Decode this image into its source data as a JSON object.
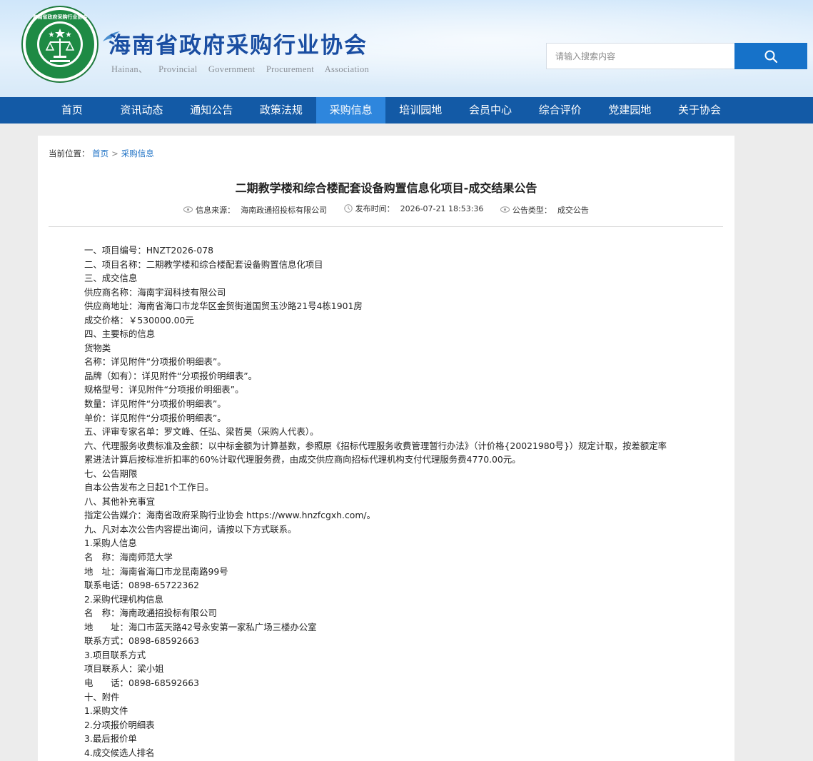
{
  "header": {
    "site_title": "海南省政府采购行业协会",
    "site_subtitle": "Hainan、 Provincial Government Procurement Association",
    "logo_name": "association-seal-logo",
    "search": {
      "placeholder": "请输入搜索内容",
      "icon": "search-icon"
    }
  },
  "nav": {
    "items": [
      {
        "label": "首页"
      },
      {
        "label": "资讯动态"
      },
      {
        "label": "通知公告"
      },
      {
        "label": "政策法规"
      },
      {
        "label": "采购信息",
        "active": true
      },
      {
        "label": "培训园地"
      },
      {
        "label": "会员中心"
      },
      {
        "label": "综合评价"
      },
      {
        "label": "党建园地"
      },
      {
        "label": "关于协会"
      }
    ],
    "active_color": "#2e86dd",
    "bar_color": "#135aa6"
  },
  "breadcrumb": {
    "prefix": "当前位置：",
    "home": "首页",
    "separator": ">",
    "current": "采购信息"
  },
  "article": {
    "title": "二期教学楼和综合楼配套设备购置信息化项目-成交结果公告",
    "meta": {
      "source_label": "信息来源：",
      "source": "海南政通招投标有限公司",
      "time_label": "发布时间：",
      "time": "2026-07-21 18:53:36",
      "type_label": "公告类型：",
      "type": "成交公告"
    },
    "lines": [
      "一、项目编号：HNZT2026-078",
      "二、项目名称：二期教学楼和综合楼配套设备购置信息化项目",
      "三、成交信息",
      "供应商名称：海南宇润科技有限公司",
      "供应商地址：海南省海口市龙华区金贸街道国贸玉沙路21号4栋1901房",
      "成交价格：￥530000.00元",
      "四、主要标的信息",
      "货物类",
      "名称：详见附件“分项报价明细表”。",
      "品牌（如有）：详见附件“分项报价明细表”。",
      "规格型号：详见附件“分项报价明细表”。",
      "数量：详见附件“分项报价明细表”。",
      "单价：详见附件“分项报价明细表”。",
      "五、评审专家名单：罗文峰、任弘、梁哲昊（采购人代表）。",
      "六、代理服务收费标准及金额：以中标金额为计算基数，参照原《招标代理服务收费管理暂行办法》（计价格{20021980号}）规定计取，按差额定率",
      "累进法计算后按标准折扣率的60%计取代理服务费，由成交供应商向招标代理机构支付代理服务费4770.00元。",
      "七、公告期限",
      "自本公告发布之日起1个工作日。",
      "八、其他补充事宜",
      "指定公告媒介：海南省政府采购行业协会 https://www.hnzfcgxh.com/。",
      "九、凡对本次公告内容提出询问，请按以下方式联系。",
      "1.采购人信息",
      "名　称：海南师范大学",
      "地　址：海南省海口市龙昆南路99号",
      "联系电话：0898-65722362",
      "2.采购代理机构信息",
      "名　称：海南政通招投标有限公司",
      "地　　址：海口市蓝天路42号永安第一家私广场三楼办公室",
      "联系方式：0898-68592663",
      "3.项目联系方式",
      "项目联系人：梁小姐",
      "电　　话：0898-68592663",
      "十、附件",
      "1.采购文件",
      "2.分项报价明细表",
      "3.最后报价单",
      "4.成交候选人排名"
    ]
  }
}
